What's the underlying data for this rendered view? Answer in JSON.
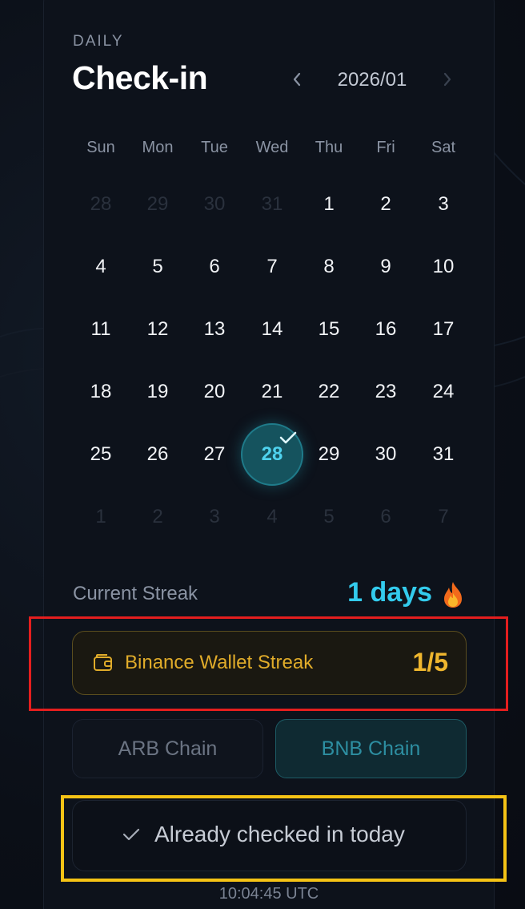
{
  "header": {
    "eyebrow": "DAILY",
    "title": "Check-in",
    "month": "2026/01",
    "prev_icon": "chevron-left-icon",
    "next_icon": "chevron-right-icon"
  },
  "calendar": {
    "weekdays": [
      "Sun",
      "Mon",
      "Tue",
      "Wed",
      "Thu",
      "Fri",
      "Sat"
    ],
    "weeks": [
      [
        {
          "d": "28",
          "muted": true
        },
        {
          "d": "29",
          "muted": true
        },
        {
          "d": "30",
          "muted": true
        },
        {
          "d": "31",
          "muted": true
        },
        {
          "d": "1"
        },
        {
          "d": "2"
        },
        {
          "d": "3"
        }
      ],
      [
        {
          "d": "4"
        },
        {
          "d": "5"
        },
        {
          "d": "6"
        },
        {
          "d": "7"
        },
        {
          "d": "8"
        },
        {
          "d": "9"
        },
        {
          "d": "10"
        }
      ],
      [
        {
          "d": "11"
        },
        {
          "d": "12"
        },
        {
          "d": "13"
        },
        {
          "d": "14"
        },
        {
          "d": "15"
        },
        {
          "d": "16"
        },
        {
          "d": "17"
        }
      ],
      [
        {
          "d": "18"
        },
        {
          "d": "19"
        },
        {
          "d": "20"
        },
        {
          "d": "21"
        },
        {
          "d": "22"
        },
        {
          "d": "23"
        },
        {
          "d": "24"
        }
      ],
      [
        {
          "d": "25"
        },
        {
          "d": "26"
        },
        {
          "d": "27"
        },
        {
          "d": "28",
          "today": true,
          "checked": true
        },
        {
          "d": "29"
        },
        {
          "d": "30"
        },
        {
          "d": "31"
        }
      ],
      [
        {
          "d": "1",
          "muted": true
        },
        {
          "d": "2",
          "muted": true
        },
        {
          "d": "3",
          "muted": true
        },
        {
          "d": "4",
          "muted": true
        },
        {
          "d": "5",
          "muted": true
        },
        {
          "d": "6",
          "muted": true
        },
        {
          "d": "7",
          "muted": true
        }
      ]
    ]
  },
  "streak": {
    "label": "Current Streak",
    "value": "1 days",
    "icon": "fire-icon"
  },
  "wallet": {
    "label": "Binance Wallet Streak",
    "count": "1/5",
    "icon": "wallet-icon"
  },
  "chains": {
    "arb_label": "ARB Chain",
    "bnb_label": "BNB Chain",
    "selected": "BNB Chain"
  },
  "checkin": {
    "label": "Already checked in today",
    "icon": "check-icon"
  },
  "time": "10:04:45 UTC",
  "colors": {
    "accent": "#33cbed",
    "wallet": "#e1ac2a",
    "highlight_red": "#e41e1e",
    "highlight_yellow": "#f5c315"
  }
}
